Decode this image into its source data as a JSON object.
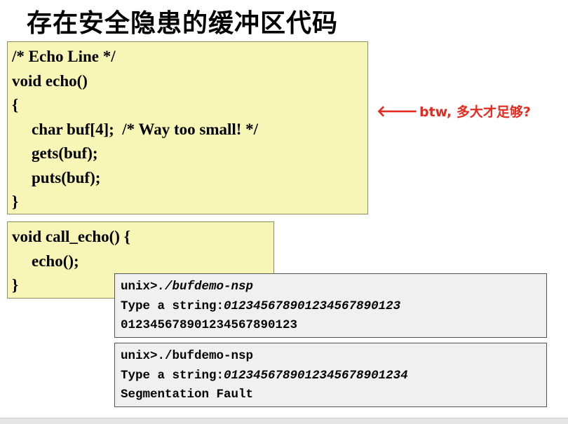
{
  "title": "存在安全隐患的缓冲区代码",
  "echo_code": [
    "/* Echo Line */",
    "void echo()",
    "{",
    "char buf[4];  /* Way too small! */",
    "gets(buf);",
    "puts(buf);",
    "}"
  ],
  "call_code": [
    "void call_echo() {",
    "echo();",
    "}"
  ],
  "note": {
    "arrow": "🡐",
    "text": "btw, 多大才足够?"
  },
  "terminal_1": {
    "prompt": "unix>",
    "command": "./bufdemo-nsp",
    "type_label": "Type a string:",
    "input": "012345678901234567890123",
    "output": "012345678901234567890123"
  },
  "terminal_2": {
    "prompt": "unix>",
    "command": "./bufdemo-nsp",
    "type_label": "Type a string:",
    "input": "0123456789012345678901234",
    "output": "Segmentation Fault"
  },
  "colors": {
    "code_box_bg": "#f7f6b6",
    "terminal_bg": "#f0f0f0",
    "note_color": "#e32b20"
  }
}
